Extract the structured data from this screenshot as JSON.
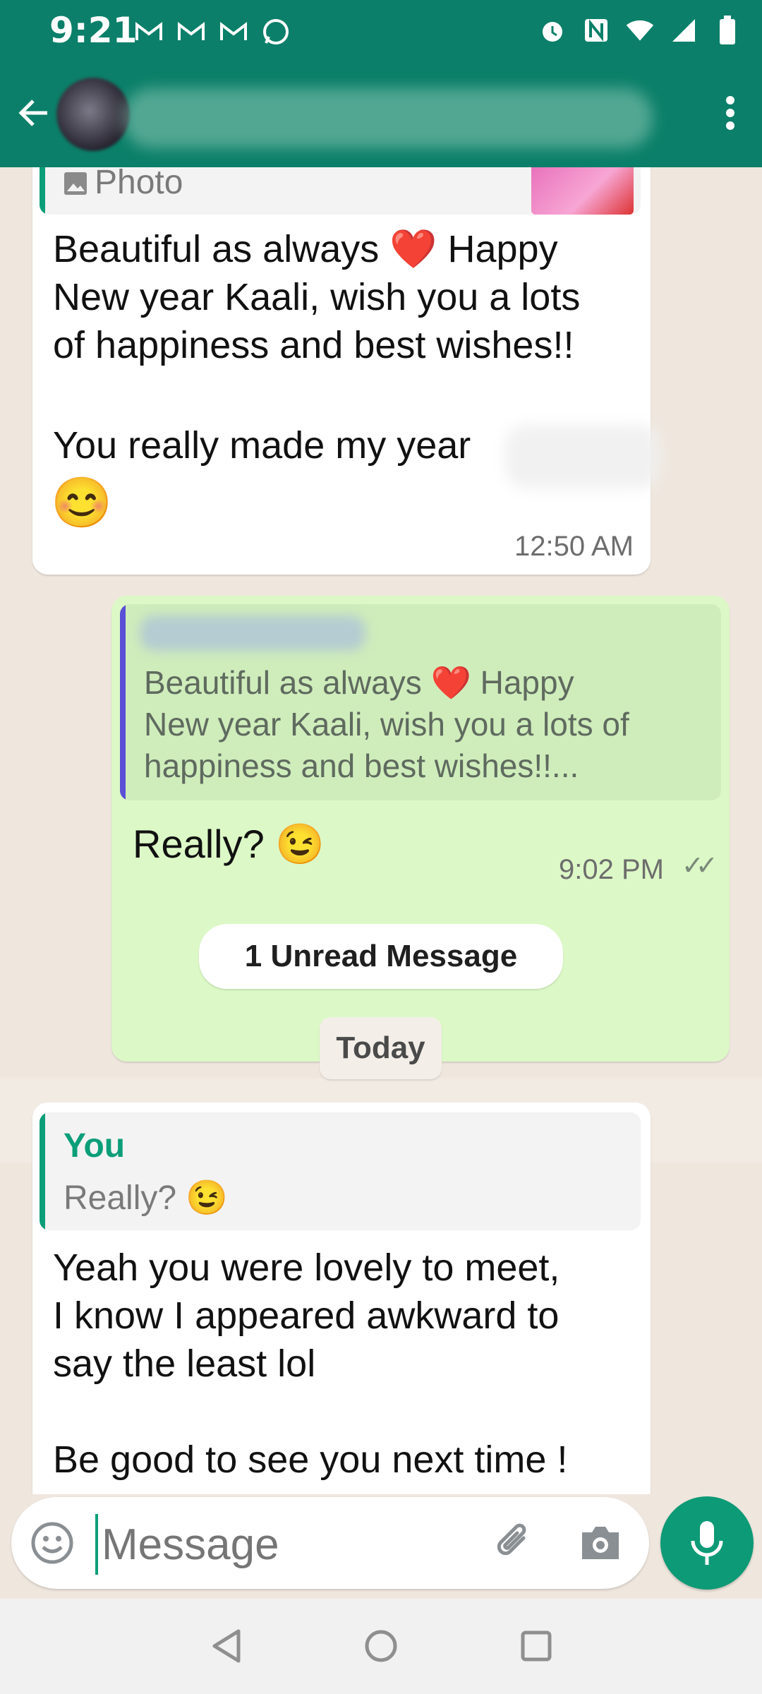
{
  "status_bar": {
    "time": "9:21",
    "left_icons": [
      "gmail-icon",
      "gmail-icon",
      "gmail-icon",
      "whatsapp-icon"
    ],
    "right_icons": [
      "alarm-icon",
      "nfc-icon",
      "wifi-icon",
      "signal-icon",
      "battery-icon"
    ]
  },
  "header": {
    "back_icon": "arrow-left-icon",
    "more_icon": "more-vertical-icon",
    "background_color": "#0b7f69"
  },
  "messages": [
    {
      "direction": "incoming",
      "quote": {
        "label": "Photo",
        "icon": "image-icon"
      },
      "text": "Beautiful as always ❤️  Happy\nNew year Kaali, wish you a lots\nof happiness and best wishes!!",
      "text2": "You really made my year",
      "emoji": "😊",
      "time": "12:50 AM"
    },
    {
      "direction": "outgoing",
      "quote_text": "Beautiful as always ❤️  Happy\nNew year Kaali, wish you a lots of\nhappiness and best wishes!!...",
      "text": "Really? 😉",
      "time": "9:02 PM",
      "ticks": "✓✓"
    }
  ],
  "unread_label": "1 Unread Message",
  "date_label": "Today",
  "reply": {
    "quote_author": "You",
    "quote_text": "Really? 😉",
    "text": "Yeah you were lovely to meet,\nI know I appeared awkward to\nsay the least lol\n\nBe good to see you next time !"
  },
  "composer": {
    "placeholder": "Message",
    "emoji_icon": "emoji-icon",
    "attach_icon": "paperclip-icon",
    "camera_icon": "camera-icon",
    "mic_icon": "microphone-icon",
    "accent_color": "#0d9a76"
  },
  "navbar": {
    "icons": [
      "back-triangle-icon",
      "home-circle-icon",
      "recents-square-icon"
    ]
  }
}
